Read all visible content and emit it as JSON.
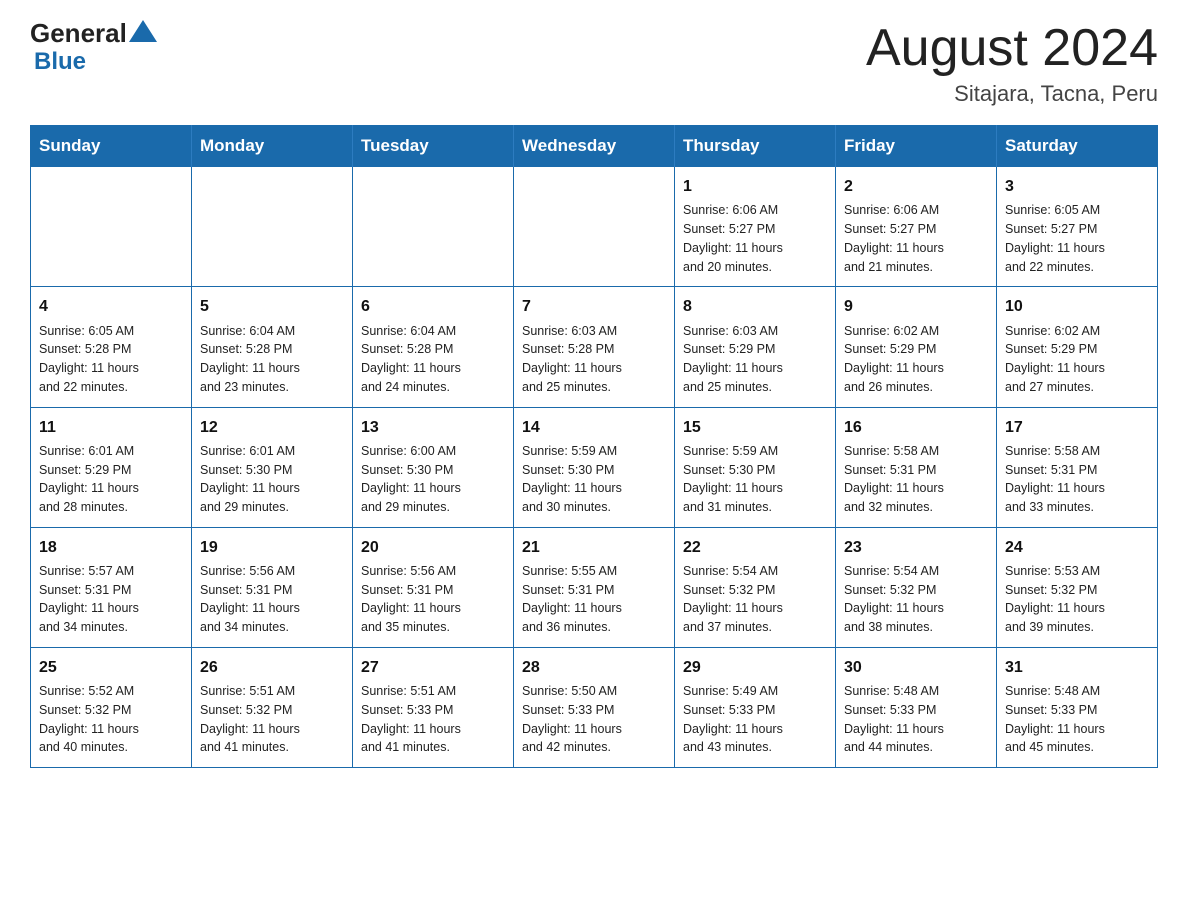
{
  "header": {
    "logo_general": "General",
    "logo_blue": "Blue",
    "month_title": "August 2024",
    "location": "Sitajara, Tacna, Peru"
  },
  "weekdays": [
    "Sunday",
    "Monday",
    "Tuesday",
    "Wednesday",
    "Thursday",
    "Friday",
    "Saturday"
  ],
  "weeks": [
    [
      {
        "day": "",
        "info": ""
      },
      {
        "day": "",
        "info": ""
      },
      {
        "day": "",
        "info": ""
      },
      {
        "day": "",
        "info": ""
      },
      {
        "day": "1",
        "info": "Sunrise: 6:06 AM\nSunset: 5:27 PM\nDaylight: 11 hours\nand 20 minutes."
      },
      {
        "day": "2",
        "info": "Sunrise: 6:06 AM\nSunset: 5:27 PM\nDaylight: 11 hours\nand 21 minutes."
      },
      {
        "day": "3",
        "info": "Sunrise: 6:05 AM\nSunset: 5:27 PM\nDaylight: 11 hours\nand 22 minutes."
      }
    ],
    [
      {
        "day": "4",
        "info": "Sunrise: 6:05 AM\nSunset: 5:28 PM\nDaylight: 11 hours\nand 22 minutes."
      },
      {
        "day": "5",
        "info": "Sunrise: 6:04 AM\nSunset: 5:28 PM\nDaylight: 11 hours\nand 23 minutes."
      },
      {
        "day": "6",
        "info": "Sunrise: 6:04 AM\nSunset: 5:28 PM\nDaylight: 11 hours\nand 24 minutes."
      },
      {
        "day": "7",
        "info": "Sunrise: 6:03 AM\nSunset: 5:28 PM\nDaylight: 11 hours\nand 25 minutes."
      },
      {
        "day": "8",
        "info": "Sunrise: 6:03 AM\nSunset: 5:29 PM\nDaylight: 11 hours\nand 25 minutes."
      },
      {
        "day": "9",
        "info": "Sunrise: 6:02 AM\nSunset: 5:29 PM\nDaylight: 11 hours\nand 26 minutes."
      },
      {
        "day": "10",
        "info": "Sunrise: 6:02 AM\nSunset: 5:29 PM\nDaylight: 11 hours\nand 27 minutes."
      }
    ],
    [
      {
        "day": "11",
        "info": "Sunrise: 6:01 AM\nSunset: 5:29 PM\nDaylight: 11 hours\nand 28 minutes."
      },
      {
        "day": "12",
        "info": "Sunrise: 6:01 AM\nSunset: 5:30 PM\nDaylight: 11 hours\nand 29 minutes."
      },
      {
        "day": "13",
        "info": "Sunrise: 6:00 AM\nSunset: 5:30 PM\nDaylight: 11 hours\nand 29 minutes."
      },
      {
        "day": "14",
        "info": "Sunrise: 5:59 AM\nSunset: 5:30 PM\nDaylight: 11 hours\nand 30 minutes."
      },
      {
        "day": "15",
        "info": "Sunrise: 5:59 AM\nSunset: 5:30 PM\nDaylight: 11 hours\nand 31 minutes."
      },
      {
        "day": "16",
        "info": "Sunrise: 5:58 AM\nSunset: 5:31 PM\nDaylight: 11 hours\nand 32 minutes."
      },
      {
        "day": "17",
        "info": "Sunrise: 5:58 AM\nSunset: 5:31 PM\nDaylight: 11 hours\nand 33 minutes."
      }
    ],
    [
      {
        "day": "18",
        "info": "Sunrise: 5:57 AM\nSunset: 5:31 PM\nDaylight: 11 hours\nand 34 minutes."
      },
      {
        "day": "19",
        "info": "Sunrise: 5:56 AM\nSunset: 5:31 PM\nDaylight: 11 hours\nand 34 minutes."
      },
      {
        "day": "20",
        "info": "Sunrise: 5:56 AM\nSunset: 5:31 PM\nDaylight: 11 hours\nand 35 minutes."
      },
      {
        "day": "21",
        "info": "Sunrise: 5:55 AM\nSunset: 5:31 PM\nDaylight: 11 hours\nand 36 minutes."
      },
      {
        "day": "22",
        "info": "Sunrise: 5:54 AM\nSunset: 5:32 PM\nDaylight: 11 hours\nand 37 minutes."
      },
      {
        "day": "23",
        "info": "Sunrise: 5:54 AM\nSunset: 5:32 PM\nDaylight: 11 hours\nand 38 minutes."
      },
      {
        "day": "24",
        "info": "Sunrise: 5:53 AM\nSunset: 5:32 PM\nDaylight: 11 hours\nand 39 minutes."
      }
    ],
    [
      {
        "day": "25",
        "info": "Sunrise: 5:52 AM\nSunset: 5:32 PM\nDaylight: 11 hours\nand 40 minutes."
      },
      {
        "day": "26",
        "info": "Sunrise: 5:51 AM\nSunset: 5:32 PM\nDaylight: 11 hours\nand 41 minutes."
      },
      {
        "day": "27",
        "info": "Sunrise: 5:51 AM\nSunset: 5:33 PM\nDaylight: 11 hours\nand 41 minutes."
      },
      {
        "day": "28",
        "info": "Sunrise: 5:50 AM\nSunset: 5:33 PM\nDaylight: 11 hours\nand 42 minutes."
      },
      {
        "day": "29",
        "info": "Sunrise: 5:49 AM\nSunset: 5:33 PM\nDaylight: 11 hours\nand 43 minutes."
      },
      {
        "day": "30",
        "info": "Sunrise: 5:48 AM\nSunset: 5:33 PM\nDaylight: 11 hours\nand 44 minutes."
      },
      {
        "day": "31",
        "info": "Sunrise: 5:48 AM\nSunset: 5:33 PM\nDaylight: 11 hours\nand 45 minutes."
      }
    ]
  ]
}
